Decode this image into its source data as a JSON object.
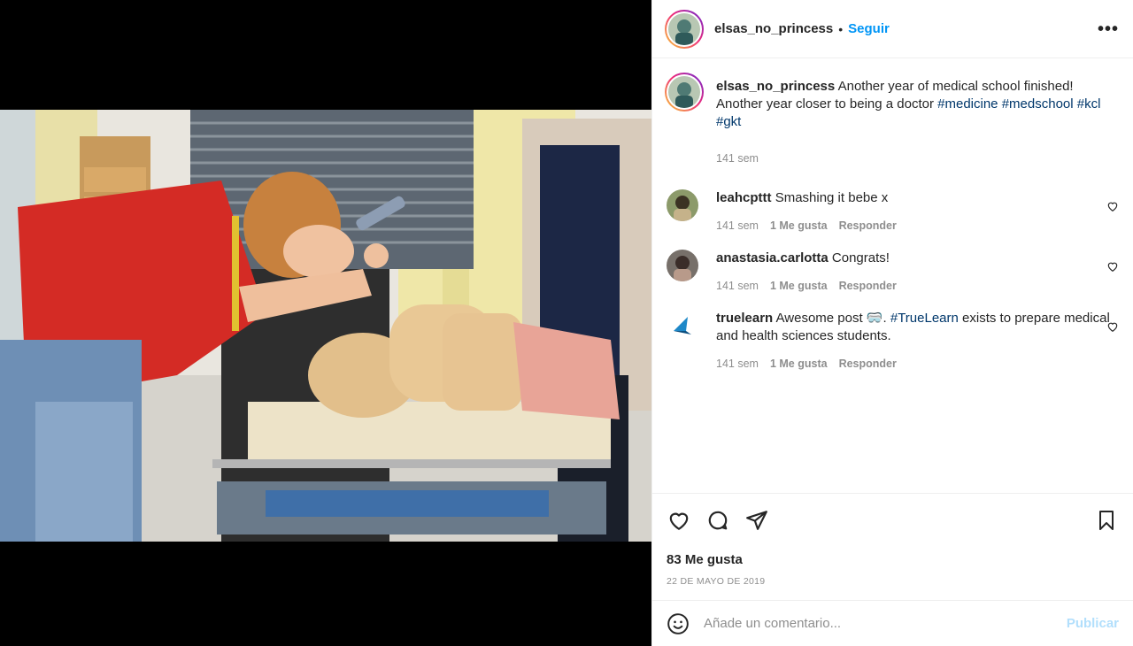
{
  "post": {
    "author": "elsas_no_princess",
    "separator": "•",
    "follow_label": "Seguir",
    "more_label": "•••"
  },
  "caption": {
    "username": "elsas_no_princess",
    "text": "Another year of medical school finished! Another year closer to being a doctor",
    "hashtags": [
      "#medicine",
      "#medschool",
      "#kcl",
      "#gkt"
    ],
    "time": "141 sem"
  },
  "comments": [
    {
      "username": "leahcpttt",
      "text": "Smashing it bebe x",
      "time": "141 sem",
      "likes": "1 Me gusta",
      "reply": "Responder",
      "avatar_color": "#6b7d4a"
    },
    {
      "username": "anastasia.carlotta",
      "text": "Congrats!",
      "time": "141 sem",
      "likes": "1 Me gusta",
      "reply": "Responder",
      "avatar_color": "#5a4a44"
    },
    {
      "username": "truelearn",
      "text_before": "Awesome post ",
      "emoji": "🥽",
      "text_mid": ". ",
      "tag": "#TrueLearn",
      "text_after": " exists to prepare medical and health sciences students.",
      "time": "141 sem",
      "likes": "1 Me gusta",
      "reply": "Responder",
      "avatar_color": "#1e88c8"
    }
  ],
  "actions": {
    "likes": "83 Me gusta",
    "date": "22 DE MAYO DE 2019"
  },
  "composer": {
    "placeholder": "Añade un comentario...",
    "publish_label": "Publicar"
  },
  "colors": {
    "accent": "#0095f6",
    "tag": "#00376b",
    "muted": "#8e8e8e",
    "publish_disabled": "#b2dffc"
  }
}
